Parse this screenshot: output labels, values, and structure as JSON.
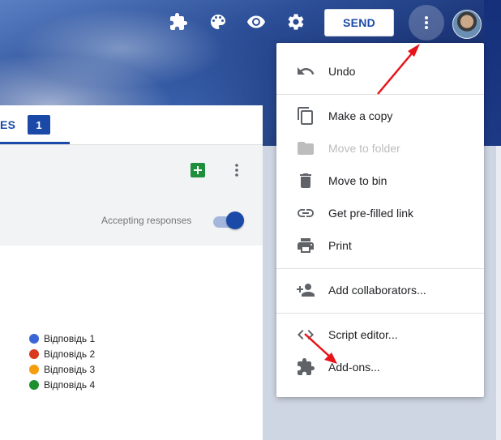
{
  "toolbar": {
    "send_label": "SEND",
    "icons": [
      "addons-icon",
      "palette-icon",
      "preview-icon",
      "settings-icon",
      "more-vert-icon"
    ]
  },
  "tabs": {
    "responses_label": "ES",
    "responses_count": "1"
  },
  "summary": {
    "accepting_label": "Accepting responses",
    "accepting_on": true
  },
  "legend": [
    {
      "label": "Відповідь 1",
      "color": "#3b66d6"
    },
    {
      "label": "Відповідь 2",
      "color": "#d9391f"
    },
    {
      "label": "Відповідь 3",
      "color": "#f59d0d"
    },
    {
      "label": "Відповідь 4",
      "color": "#1e8e2e"
    }
  ],
  "menu": {
    "undo": "Undo",
    "make_copy": "Make a copy",
    "move_to_folder": "Move to folder",
    "move_to_bin": "Move to bin",
    "prefilled_link": "Get pre-filled link",
    "print": "Print",
    "add_collaborators": "Add collaborators...",
    "script_editor": "Script editor...",
    "addons": "Add-ons..."
  },
  "colors": {
    "accent": "#1a49a8",
    "arrow": "#e8141b"
  }
}
